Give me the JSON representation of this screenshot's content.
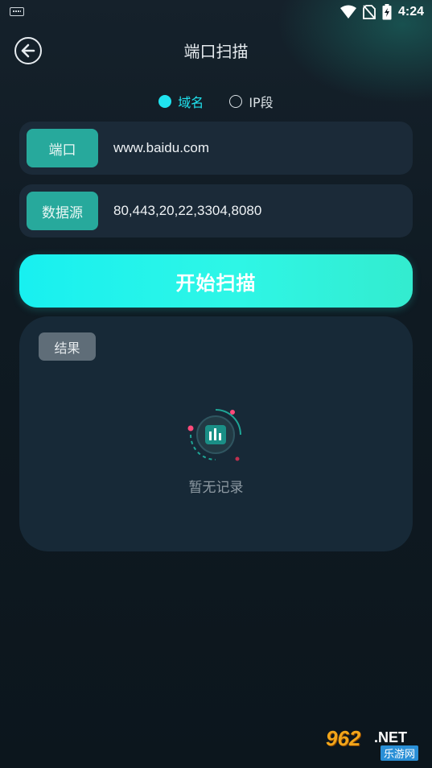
{
  "status_bar": {
    "time": "4:24",
    "icons": [
      "keyboard-icon",
      "wifi-icon",
      "no-sim-icon",
      "battery-charging-icon"
    ]
  },
  "header": {
    "title": "端口扫描",
    "back_icon": "arrow-left-circle-icon"
  },
  "mode_options": [
    {
      "label": "域名",
      "selected": true
    },
    {
      "label": "IP段",
      "selected": false
    }
  ],
  "fields": {
    "host": {
      "tag": "端口",
      "value": "www.baidu.com"
    },
    "ports": {
      "tag": "数据源",
      "value": "80,443,20,22,3304,8080"
    }
  },
  "scan_button": {
    "label": "开始扫描"
  },
  "result": {
    "tag": "结果",
    "empty_text": "暂无记录",
    "empty_icon": "bar-chart-icon"
  },
  "watermark": {
    "logo": "962",
    "suffix": ".NET",
    "sub": "乐游网"
  },
  "colors": {
    "accent": "#20e3ef",
    "tag_bg": "#27a99c",
    "row_bg": "#1b2a38",
    "card_bg": "#172937",
    "page_bg": "#0e1820"
  }
}
